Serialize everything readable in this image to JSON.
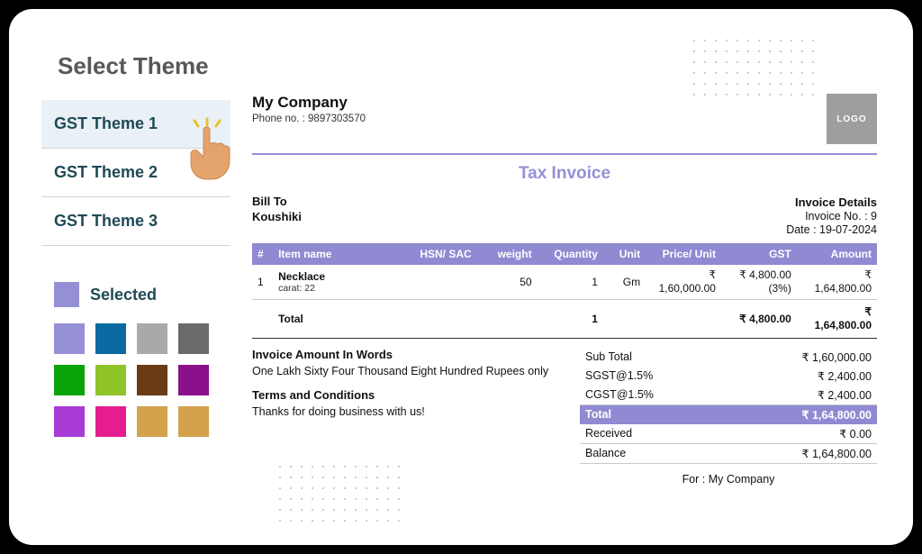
{
  "sidebar": {
    "title": "Select Theme",
    "themes": [
      {
        "label": "GST Theme 1",
        "active": true
      },
      {
        "label": "GST Theme 2",
        "active": false
      },
      {
        "label": "GST Theme 3",
        "active": false
      }
    ],
    "selected_label": "Selected",
    "selected_color": "#9590d6",
    "swatches": [
      "#9590d6",
      "#0b6aa1",
      "#a9a9a9",
      "#6b6b6b",
      "#0aa30a",
      "#8fc32a",
      "#6a3b17",
      "#8b108b",
      "#a83bd6",
      "#e51d8f",
      "#d2a24c",
      "#d2a24c"
    ]
  },
  "invoice": {
    "company": {
      "name": "My Company",
      "phone_label": "Phone no. :",
      "phone": "9897303570"
    },
    "logo_text": "LOGO",
    "title": "Tax Invoice",
    "bill_to_label": "Bill To",
    "customer": "Koushiki",
    "details_label": "Invoice Details",
    "details": {
      "number_label": "Invoice No. :",
      "number": "9",
      "date_label": "Date :",
      "date": "19-07-2024"
    },
    "headers": {
      "idx": "#",
      "name": "Item name",
      "hsn": "HSN/ SAC",
      "weight": "weight",
      "qty": "Quantity",
      "unit": "Unit",
      "price": "Price/ Unit",
      "gst": "GST",
      "amount": "Amount"
    },
    "items": [
      {
        "idx": "1",
        "name": "Necklace",
        "sub": "carat: 22",
        "hsn": "",
        "weight": "50",
        "qty": "1",
        "unit": "Gm",
        "price_top": "₹",
        "price": "1,60,000.00",
        "gst_top": "₹ 4,800.00",
        "gst": "(3%)",
        "amount_top": "₹",
        "amount": "1,64,800.00"
      }
    ],
    "total_row": {
      "label": "Total",
      "qty": "1",
      "gst": "₹ 4,800.00",
      "amount_top": "₹",
      "amount": "1,64,800.00"
    },
    "words_label": "Invoice Amount In Words",
    "words": "One Lakh Sixty Four Thousand Eight Hundred Rupees only",
    "terms_label": "Terms and Conditions",
    "terms": "Thanks for doing business with us!",
    "summary": {
      "subtotal_label": "Sub Total",
      "subtotal": "₹ 1,60,000.00",
      "sgst_label": "SGST@1.5%",
      "sgst": "₹ 2,400.00",
      "cgst_label": "CGST@1.5%",
      "cgst": "₹ 2,400.00",
      "total_label": "Total",
      "total": "₹ 1,64,800.00",
      "received_label": "Received",
      "received": "₹ 0.00",
      "balance_label": "Balance",
      "balance": "₹ 1,64,800.00"
    },
    "for_label": "For :",
    "for_value": "My Company"
  }
}
